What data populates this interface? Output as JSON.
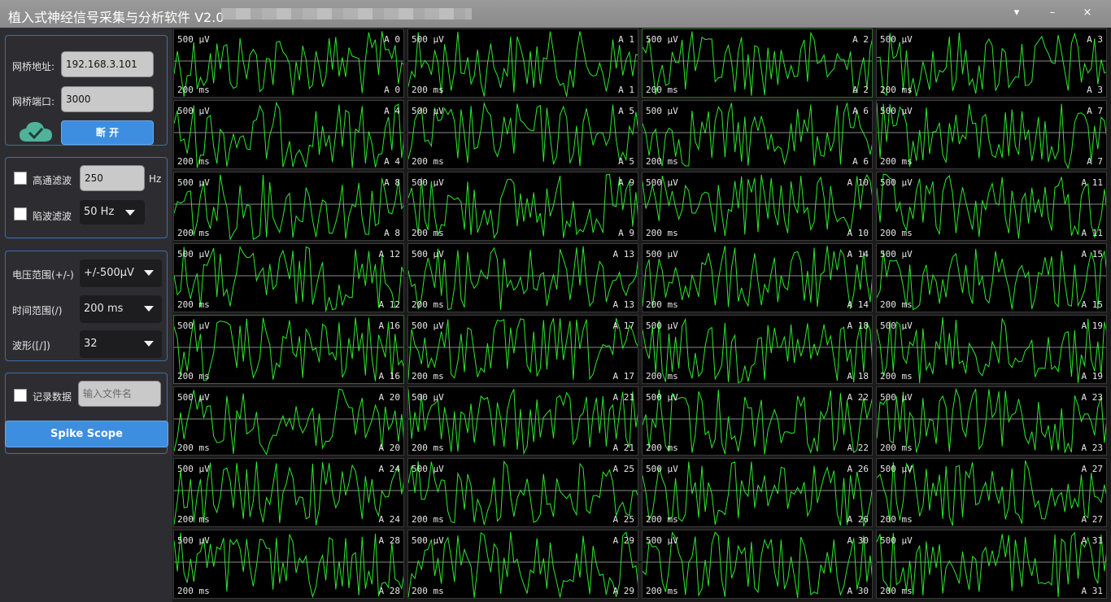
{
  "window": {
    "title": "植入式神经信号采集与分析软件 V2.0",
    "buttons": {
      "menu": "▾",
      "minimize": "–",
      "close": "×"
    }
  },
  "connection": {
    "bridge_address_label": "网桥地址:",
    "bridge_address_value": "192.168.3.101",
    "bridge_port_label": "网桥端口:",
    "bridge_port_value": "3000",
    "disconnect_label": "断 开",
    "status_icon": "cloud-check-icon",
    "status_color": "#4fb39a"
  },
  "filters": {
    "highpass_label": "高通滤波",
    "highpass_value": "250",
    "highpass_unit": "Hz",
    "highpass_checked": false,
    "notch_label": "陷波滤波",
    "notch_value": "50 Hz",
    "notch_checked": false
  },
  "display": {
    "voltage_label": "电压范围(+/-)",
    "voltage_value": "+/-500μV",
    "time_label": "时间范围(/)",
    "time_value": "200 ms",
    "waveform_label": "波形([/])",
    "waveform_value": "32"
  },
  "recording": {
    "record_label": "记录数据",
    "record_checked": false,
    "filename_placeholder": "输入文件名",
    "spike_scope_label": "Spike Scope"
  },
  "channels": [
    {
      "id": "A 0",
      "amp": "500 μV",
      "time": "200 ms"
    },
    {
      "id": "A 1",
      "amp": "500 μV",
      "time": "200 ms"
    },
    {
      "id": "A 2",
      "amp": "500 μV",
      "time": "200 ms"
    },
    {
      "id": "A 3",
      "amp": "500 μV",
      "time": "200 ms"
    },
    {
      "id": "A 4",
      "amp": "500 μV",
      "time": "200 ms"
    },
    {
      "id": "A 5",
      "amp": "500 μV",
      "time": "200 ms"
    },
    {
      "id": "A 6",
      "amp": "500 μV",
      "time": "200 ms"
    },
    {
      "id": "A 7",
      "amp": "500 μV",
      "time": "200 ms"
    },
    {
      "id": "A 8",
      "amp": "500 μV",
      "time": "200 ms"
    },
    {
      "id": "A 9",
      "amp": "500 μV",
      "time": "200 ms"
    },
    {
      "id": "A 10",
      "amp": "500 μV",
      "time": "200 ms"
    },
    {
      "id": "A 11",
      "amp": "500 μV",
      "time": "200 ms"
    },
    {
      "id": "A 12",
      "amp": "500 μV",
      "time": "200 ms"
    },
    {
      "id": "A 13",
      "amp": "500 μV",
      "time": "200 ms"
    },
    {
      "id": "A 14",
      "amp": "500 μV",
      "time": "200 ms"
    },
    {
      "id": "A 15",
      "amp": "500 μV",
      "time": "200 ms"
    },
    {
      "id": "A 16",
      "amp": "500 μV",
      "time": "200 ms"
    },
    {
      "id": "A 17",
      "amp": "500 μV",
      "time": "200 ms"
    },
    {
      "id": "A 18",
      "amp": "500 μV",
      "time": "200 ms"
    },
    {
      "id": "A 19",
      "amp": "500 μV",
      "time": "200 ms"
    },
    {
      "id": "A 20",
      "amp": "500 μV",
      "time": "200 ms"
    },
    {
      "id": "A 21",
      "amp": "500 μV",
      "time": "200 ms"
    },
    {
      "id": "A 22",
      "amp": "500 μV",
      "time": "200 ms"
    },
    {
      "id": "A 23",
      "amp": "500 μV",
      "time": "200 ms"
    },
    {
      "id": "A 24",
      "amp": "500 μV",
      "time": "200 ms"
    },
    {
      "id": "A 25",
      "amp": "500 μV",
      "time": "200 ms"
    },
    {
      "id": "A 26",
      "amp": "500 μV",
      "time": "200 ms"
    },
    {
      "id": "A 27",
      "amp": "500 μV",
      "time": "200 ms"
    },
    {
      "id": "A 28",
      "amp": "500 μV",
      "time": "200 ms"
    },
    {
      "id": "A 29",
      "amp": "500 μV",
      "time": "200 ms"
    },
    {
      "id": "A 30",
      "amp": "500 μV",
      "time": "200 ms"
    },
    {
      "id": "A 31",
      "amp": "500 μV",
      "time": "200 ms"
    }
  ],
  "colors": {
    "trace": "#2ee82e",
    "baseline": "#8a8a8a",
    "accent": "#3d8ee0",
    "selected_border": "#2f6f2f"
  }
}
